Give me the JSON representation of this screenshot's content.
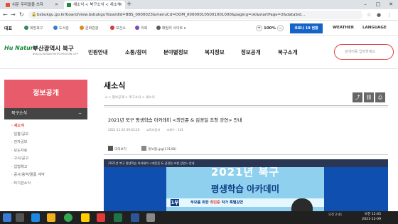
{
  "browser": {
    "tabs": [
      {
        "title": "쉬운 우리말을 쓰자",
        "color": "#e84c3d"
      },
      {
        "title": "새소식 < 북구소식 < 새소식",
        "color": "#1b8a3a"
      }
    ],
    "url": "bsbukgu.go.kr/board/view.bsbukgu?boardId=BBS_0000023&menuCd=DOM_000000105001001000&paging=ok&startPage=2&dataSid..."
  },
  "util": {
    "home": "대표",
    "links": [
      "희망북구",
      "도서관",
      "문화관광",
      "보건소",
      "의회",
      "패밀리 사이트"
    ],
    "link_colors": [
      "#2e8b57",
      "#3a7bd5",
      "#e08a1e",
      "#d23b3b",
      "#7a4bb5",
      "#5a5a5a"
    ],
    "zoom": "100%",
    "covid": "코로나 19 현황",
    "weather": "WEATHER",
    "language": "LANGUAGE"
  },
  "site": {
    "logo_mark": "Hu Nature",
    "logo_name": "부산광역시 북구",
    "logo_sub": "BUK-GU BUSAN METROPOLITAN CITY",
    "menu": [
      "민원안내",
      "소통/참여",
      "분야별정보",
      "복지정보",
      "정보공개",
      "북구소개"
    ],
    "search_placeholder": "검색어를 입력하세요"
  },
  "sidebar": {
    "heading": "정보공개",
    "category": "북구소식",
    "items": [
      "새소식",
      "입찰/공모",
      "전자공보",
      "보도자료",
      "고시/공고",
      "입법예고",
      "공사/용역/물품 계약",
      "타기관소식"
    ]
  },
  "post": {
    "section_title": "새소식",
    "breadcrumb": "⌂ > 정보공개 > 북구소식 > 새소식",
    "title": "2021년 북구 평생학습 아카데미 <최민준 & 김경일 초청 강연> 안내",
    "date": "2021-11-22 09:52:20",
    "dept": "교육지원과",
    "views": "조회수 : 101",
    "attach_label": "미리보기",
    "attach_file": "홍보물.jpg(1314B)",
    "caption": "2021년 북구 평생학습 아카데미 <최민준 & 김경일 초청 강연> 안내",
    "poster_year": "2021년 북구",
    "poster_title": "평생학습 아카데미",
    "poster_num": "1부",
    "poster_sub_pre": "부모를 위한 ",
    "poster_sub_name": "최민준",
    "poster_sub_post": " 작가 특별강연"
  },
  "taskbar": {
    "tray": "오전 2:41",
    "time": "오전 12:45",
    "date": "2021-12-09"
  }
}
